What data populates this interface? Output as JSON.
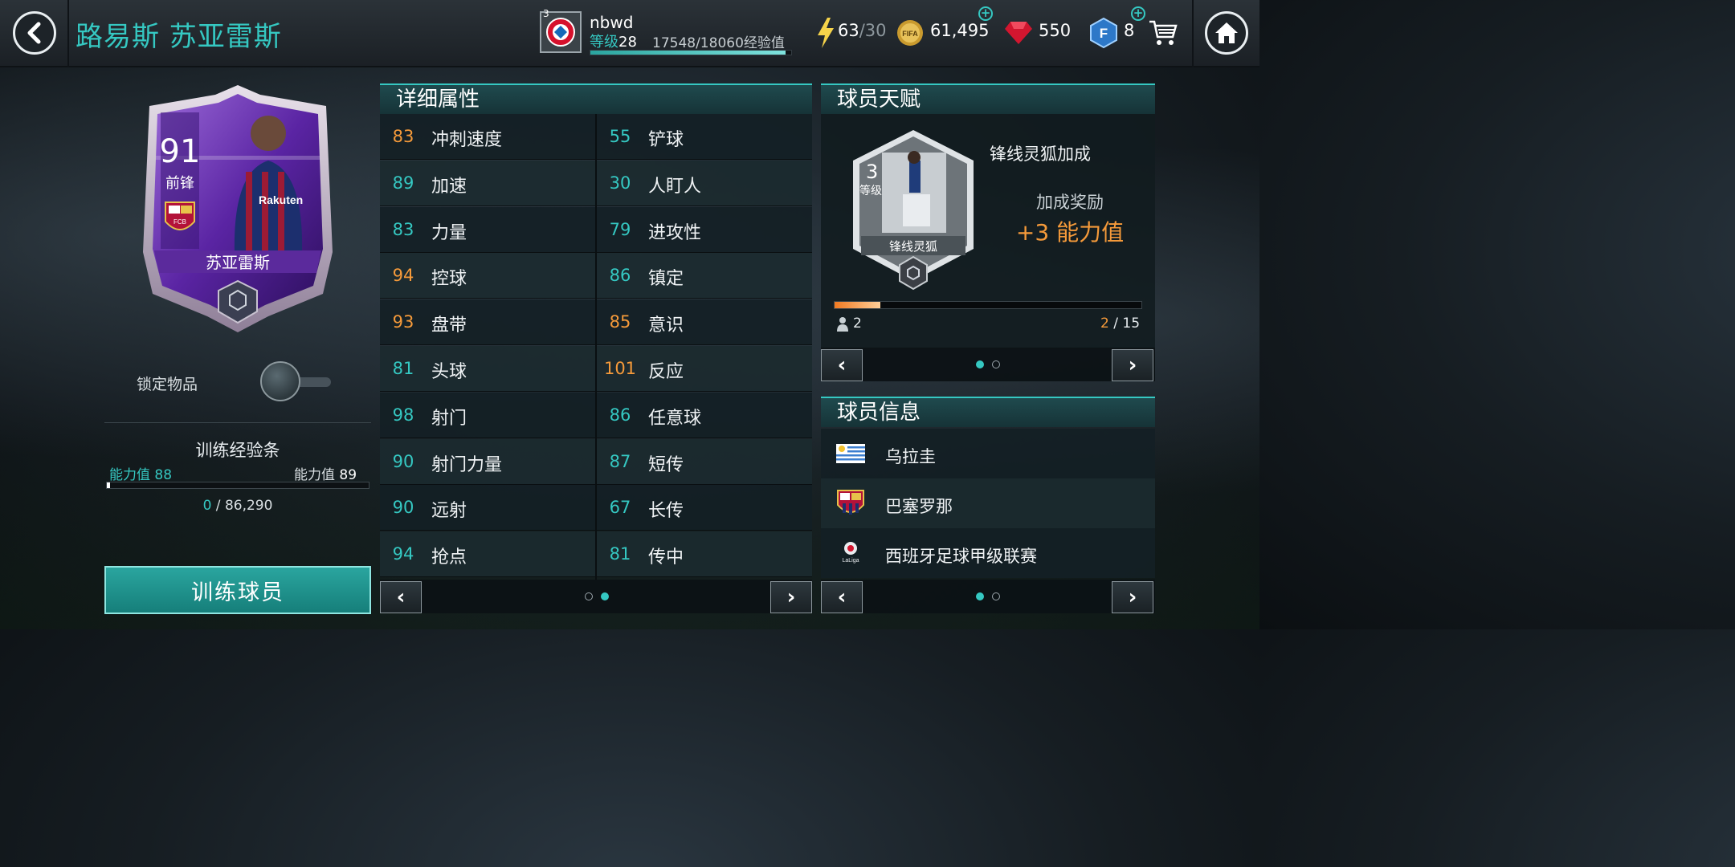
{
  "header": {
    "player_title": "路易斯 苏亚雷斯",
    "user": {
      "badge_level": "3",
      "name": "nbwd",
      "level_label": "等级",
      "level": "28",
      "xp_text": "17548/18060经验值",
      "xp_fraction": 0.97
    },
    "stamina": {
      "current": "63",
      "max": "/30"
    },
    "coins": "61,495",
    "gems": "550",
    "fifa_points": "8"
  },
  "card": {
    "rating": "91",
    "position": "前锋",
    "name": "苏亚雷斯",
    "sponsor": "Rakuten",
    "club_badge_text": "FCB"
  },
  "lock": {
    "label": "锁定物品",
    "on": false
  },
  "training": {
    "title": "训练经验条",
    "ovr_label": "能力值",
    "ovr_current": "88",
    "ovr_next": "89",
    "progress_current": "0",
    "progress_sep": "/",
    "progress_max": "86,290",
    "button": "训练球员"
  },
  "attributes": {
    "title": "详细属性",
    "left": [
      {
        "value": "83",
        "name": "冲刺速度",
        "color": "#f59a3a"
      },
      {
        "value": "89",
        "name": "加速",
        "color": "#35c8c2"
      },
      {
        "value": "83",
        "name": "力量",
        "color": "#35c8c2"
      },
      {
        "value": "94",
        "name": "控球",
        "color": "#f59a3a"
      },
      {
        "value": "93",
        "name": "盘带",
        "color": "#f59a3a"
      },
      {
        "value": "81",
        "name": "头球",
        "color": "#35c8c2"
      },
      {
        "value": "98",
        "name": "射门",
        "color": "#35c8c2"
      },
      {
        "value": "90",
        "name": "射门力量",
        "color": "#35c8c2"
      },
      {
        "value": "90",
        "name": "远射",
        "color": "#35c8c2"
      },
      {
        "value": "94",
        "name": "抢点",
        "color": "#35c8c2"
      }
    ],
    "right": [
      {
        "value": "55",
        "name": "铲球",
        "color": "#35c8c2"
      },
      {
        "value": "30",
        "name": "人盯人",
        "color": "#35c8c2"
      },
      {
        "value": "79",
        "name": "进攻性",
        "color": "#35c8c2"
      },
      {
        "value": "86",
        "name": "镇定",
        "color": "#35c8c2"
      },
      {
        "value": "85",
        "name": "意识",
        "color": "#f59a3a"
      },
      {
        "value": "101",
        "name": "反应",
        "color": "#f59a3a"
      },
      {
        "value": "86",
        "name": "任意球",
        "color": "#35c8c2"
      },
      {
        "value": "87",
        "name": "短传",
        "color": "#35c8c2"
      },
      {
        "value": "67",
        "name": "长传",
        "color": "#35c8c2"
      },
      {
        "value": "81",
        "name": "传中",
        "color": "#35c8c2"
      }
    ],
    "nav": {
      "prev": "‹",
      "next": "›",
      "page": 2,
      "pages": 2
    }
  },
  "talent": {
    "title": "球员天赋",
    "level": "3",
    "level_label": "等级",
    "badge_name": "锋线灵狐",
    "name": "锋线灵狐加成",
    "bonus_label": "加成奖励",
    "bonus_value": "+3 能力值",
    "count": "2",
    "points_current": "2",
    "points_sep": "/ ",
    "points_max": "15",
    "progress_fraction": 0.15,
    "nav": {
      "prev": "‹",
      "next": "›",
      "page": 1,
      "pages": 2
    }
  },
  "info": {
    "title": "球员信息",
    "nation": "乌拉圭",
    "club": "巴塞罗那",
    "league": "西班牙足球甲级联赛",
    "league_logo_text": "LaLiga",
    "nav": {
      "prev": "‹",
      "next": "›",
      "page": 1,
      "pages": 2
    }
  },
  "colors": {
    "accent": "#35c8c2",
    "orange": "#f59a3a",
    "card_purple": "#6b2fb5"
  }
}
